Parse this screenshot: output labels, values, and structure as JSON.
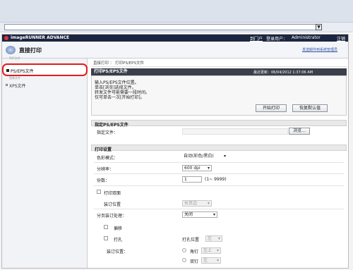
{
  "header": {
    "brand": "imageRUNNER ADVANCE",
    "portal": "到门户",
    "login_user_label": "登录用户：",
    "username": "Administrator",
    "logout": "注销",
    "page_title": "直接打印",
    "email_link": "发送邮件到系统管理员"
  },
  "sidebar": {
    "items": [
      {
        "label": "PDF文件"
      },
      {
        "label": "PS/EPS文件"
      },
      {
        "label": "图像文件"
      },
      {
        "label": "XPS文件"
      }
    ]
  },
  "breadcrumb": "直接打印 ： 打印PS/EPS文件",
  "panel": {
    "title": "打印PS/EPS文件",
    "last_updated": "最近更新：06/04/2012 1:37:06 AM",
    "instructions": [
      "输入PS/EPS文件位置。",
      "单击[浏览]选择文件。",
      "转发文件可能需要一段时间。",
      "仅可单击一次[开始打印]。"
    ],
    "start_print": "开始打印",
    "restore_default": "恢复默认值"
  },
  "file_section": {
    "title": "指定PS/EPS文件",
    "label": "指定文件：",
    "browse": "浏览..."
  },
  "print_settings": {
    "title": "打印设置",
    "color_mode_label": "色彩模式：",
    "color_mode_value": "自动(彩色/黑白)",
    "resolution_label": "分辨率：",
    "resolution_value": "600 dpi",
    "copies_label": "份数：",
    "copies_value": "1",
    "copies_range": "(1~ 9999)",
    "duplex_label": "打印双面",
    "binding_label": "装订位置",
    "binding_value": "长页边",
    "finishing_label": "分页装订处理：",
    "finishing_value": "关闭",
    "offset_label": "偏移",
    "punch_label": "打孔",
    "punch_pos_label": "打孔位置",
    "punch_pos_value": "左",
    "staple_label": "装订位置：",
    "corner_label": "角钉",
    "corner_value": "左上",
    "double_label": "双钉",
    "double_value": "左"
  }
}
